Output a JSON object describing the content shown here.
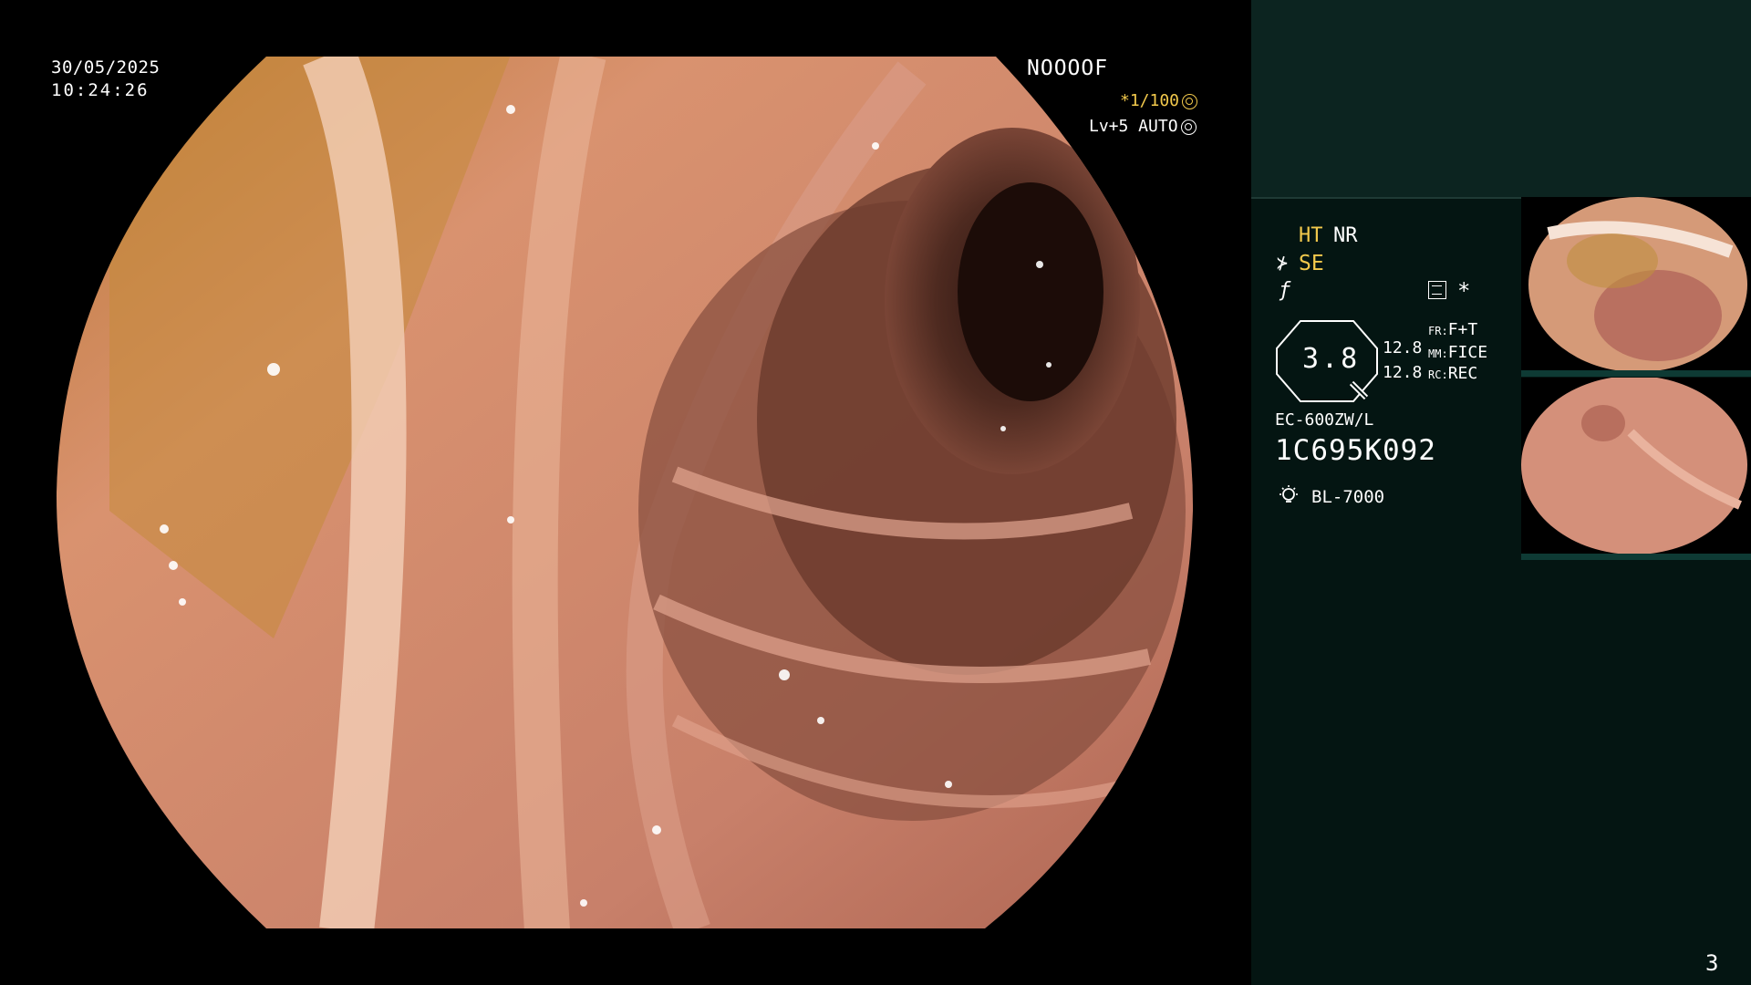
{
  "overlay": {
    "date": "30/05/2025",
    "time": "10:24:26",
    "patient_id": "NOOOOF",
    "shutter": "*1/100",
    "level": "Lv+5 AUTO"
  },
  "panel": {
    "mode_ht": "HT",
    "mode_nr": "NR",
    "mode_se": "SE",
    "zoom_value": "3.8",
    "fr_value": "12.8",
    "mm_value": "12.8",
    "fr_label": "FR:",
    "fr_text": "F+T",
    "mm_label": "MM:",
    "mm_text": "FICE",
    "rc_label": "RC:",
    "rc_text": "REC",
    "scope_model": "EC-600ZW/L",
    "scope_serial": "1C695K092",
    "light_source": "BL-7000",
    "page_number": "3"
  },
  "colors": {
    "accent_yellow": "#f2c94c",
    "panel_bg": "#041512",
    "panel_top_bg": "#0c2420"
  },
  "icons": [
    "exposure-icon",
    "se-mode-icon",
    "f-mode-icon",
    "grid-icon",
    "star-icon",
    "magnifier-icon",
    "light-bulb-icon"
  ]
}
